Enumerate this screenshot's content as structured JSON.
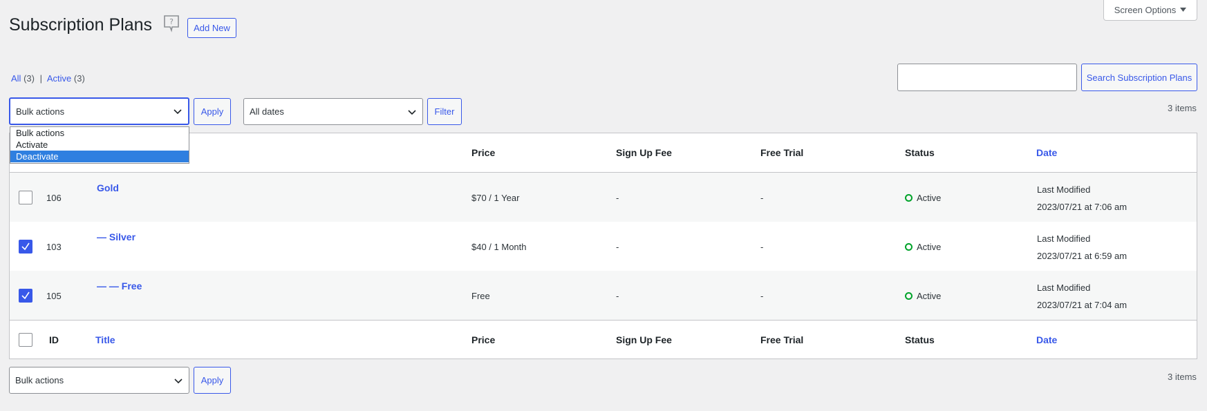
{
  "header": {
    "title": "Subscription Plans",
    "add_new": "Add New",
    "screen_options": "Screen Options"
  },
  "views": {
    "all_label": "All",
    "all_count": "(3)",
    "separator": "|",
    "active_label": "Active",
    "active_count": "(3)"
  },
  "search": {
    "button": "Search Subscription Plans",
    "value": ""
  },
  "top_nav": {
    "bulk_selected": "Bulk actions",
    "apply": "Apply",
    "dates_selected": "All dates",
    "filter": "Filter",
    "items": "3 items"
  },
  "bulk_dropdown": {
    "options": [
      "Bulk actions",
      "Activate",
      "Deactivate"
    ],
    "highlighted": "Deactivate"
  },
  "columns": {
    "id": "ID",
    "title": "Title",
    "price": "Price",
    "sign_up_fee": "Sign Up Fee",
    "free_trial": "Free Trial",
    "status": "Status",
    "date": "Date"
  },
  "rows": [
    {
      "checked": false,
      "id": "106",
      "title": "Gold",
      "price": "$70 / 1 Year",
      "sign_up_fee": "-",
      "free_trial": "-",
      "status": "Active",
      "date_label": "Last Modified",
      "date_value": "2023/07/21 at 7:06 am"
    },
    {
      "checked": true,
      "id": "103",
      "title": "— Silver",
      "price": "$40 / 1 Month",
      "sign_up_fee": "-",
      "free_trial": "-",
      "status": "Active",
      "date_label": "Last Modified",
      "date_value": "2023/07/21 at 6:59 am"
    },
    {
      "checked": true,
      "id": "105",
      "title": "— — Free",
      "price": "Free",
      "sign_up_fee": "-",
      "free_trial": "-",
      "status": "Active",
      "date_label": "Last Modified",
      "date_value": "2023/07/21 at 7:04 am"
    }
  ],
  "bottom_nav": {
    "bulk_selected": "Bulk actions",
    "apply": "Apply",
    "items": "3 items"
  },
  "colors": {
    "accent": "#3858e9",
    "active_status": "#00a32a"
  },
  "icons": [
    "help-icon",
    "chevron-down-icon",
    "caret-down-icon",
    "checkmark-icon",
    "status-circle-icon"
  ]
}
